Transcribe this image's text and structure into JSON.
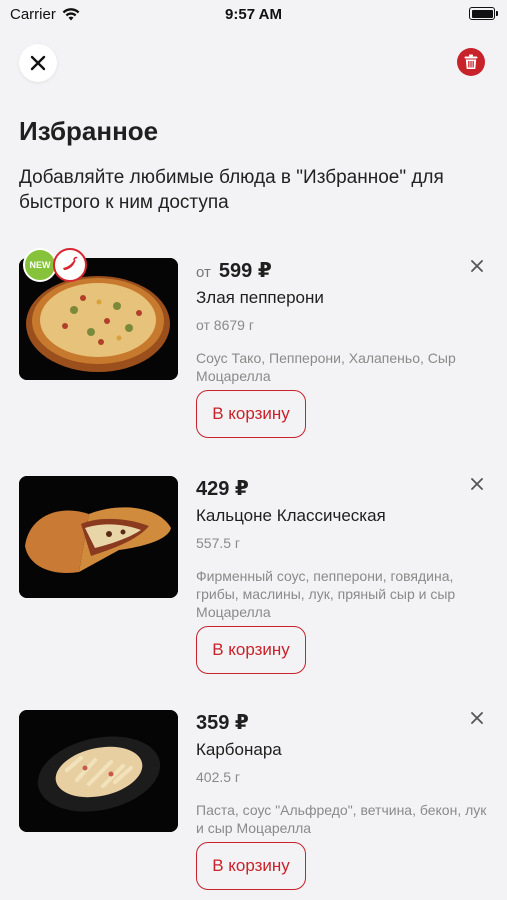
{
  "status_bar": {
    "carrier": "Carrier",
    "time": "9:57 AM"
  },
  "header": {
    "title": "Избранное",
    "subtitle": "Добавляйте любимые блюда в \"Избранное\" для быстрого к ним доступа"
  },
  "products": [
    {
      "price_prefix": "от",
      "price": "599 ₽",
      "name": "Злая пепперони",
      "weight": "от 8679 г",
      "description": "Соус Тако, Пепперони, Халапеньо, Сыр Моцарелла",
      "cart_label": "В корзину",
      "badge_new": "NEW",
      "image_icon": "pizza-image"
    },
    {
      "price": "429 ₽",
      "name": "Кальцоне Классическая",
      "weight": "557.5 г",
      "description": "Фирменный соус, пепперони, говядина, грибы, маслины, лук, пряный сыр и сыр Моцарелла",
      "cart_label": "В корзину",
      "image_icon": "calzone-image"
    },
    {
      "price": "359 ₽",
      "name": "Карбонара",
      "weight": "402.5 г",
      "description": "Паста, соус \"Альфредо\", ветчина, бекон, лук и сыр Моцарелла",
      "cart_label": "В корзину",
      "image_icon": "pasta-image"
    }
  ],
  "colors": {
    "accent": "#c8222b",
    "background": "#f3f3f5",
    "muted_text": "#8a8a8a",
    "badge_new": "#86c33a"
  }
}
